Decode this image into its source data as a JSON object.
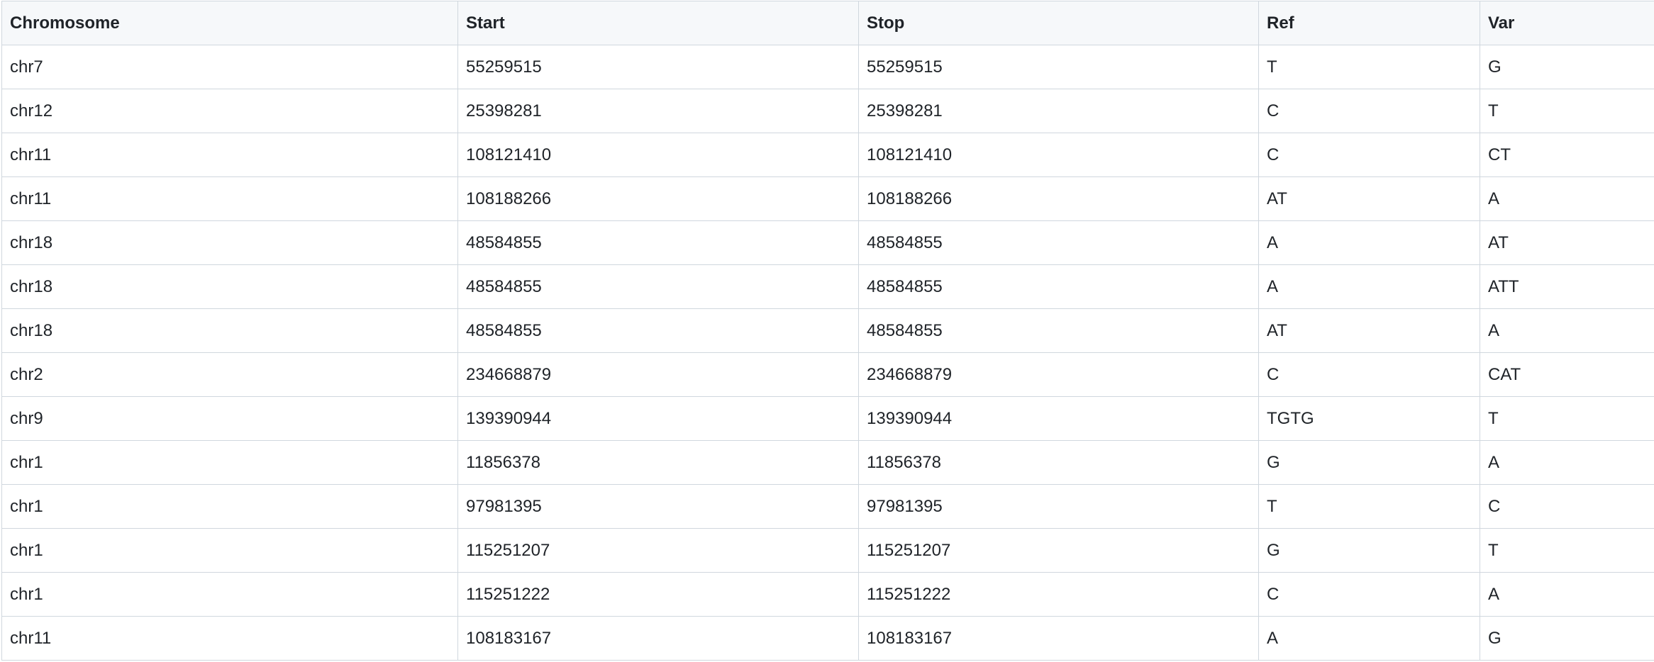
{
  "table": {
    "columns": [
      "Chromosome",
      "Start",
      "Stop",
      "Ref",
      "Var"
    ],
    "rows": [
      [
        "chr7",
        "55259515",
        "55259515",
        "T",
        "G"
      ],
      [
        "chr12",
        "25398281",
        "25398281",
        "C",
        "T"
      ],
      [
        "chr11",
        "108121410",
        "108121410",
        "C",
        "CT"
      ],
      [
        "chr11",
        "108188266",
        "108188266",
        "AT",
        "A"
      ],
      [
        "chr18",
        "48584855",
        "48584855",
        "A",
        "AT"
      ],
      [
        "chr18",
        "48584855",
        "48584855",
        "A",
        "ATT"
      ],
      [
        "chr18",
        "48584855",
        "48584855",
        "AT",
        "A"
      ],
      [
        "chr2",
        "234668879",
        "234668879",
        "C",
        "CAT"
      ],
      [
        "chr9",
        "139390944",
        "139390944",
        "TGTG",
        "T"
      ],
      [
        "chr1",
        "11856378",
        "11856378",
        "G",
        "A"
      ],
      [
        "chr1",
        "97981395",
        "97981395",
        "T",
        "C"
      ],
      [
        "chr1",
        "115251207",
        "115251207",
        "G",
        "T"
      ],
      [
        "chr1",
        "115251222",
        "115251222",
        "C",
        "A"
      ],
      [
        "chr11",
        "108183167",
        "108183167",
        "A",
        "G"
      ]
    ]
  }
}
